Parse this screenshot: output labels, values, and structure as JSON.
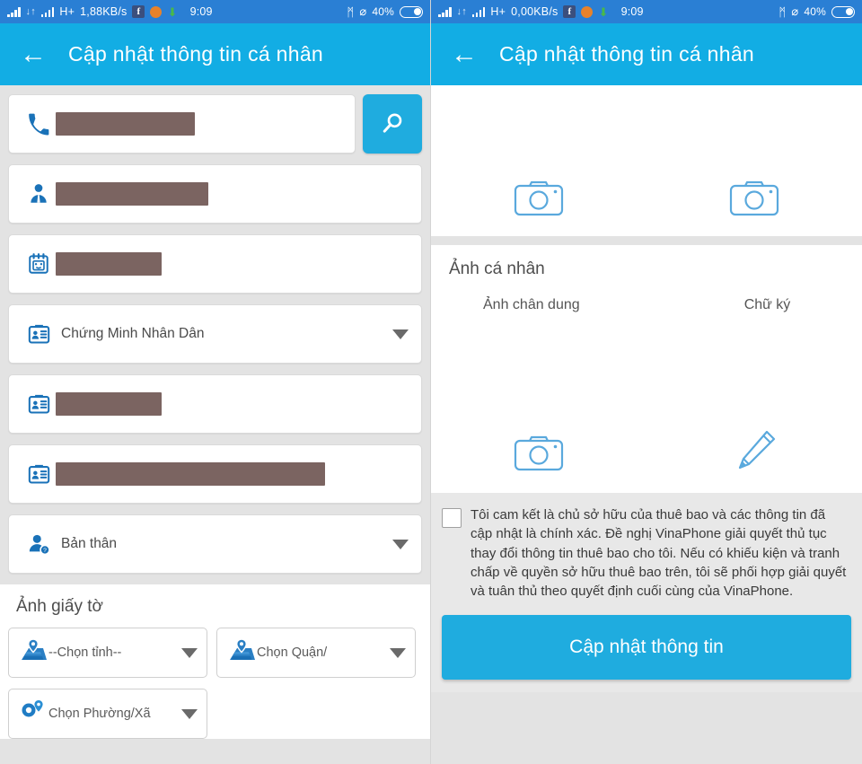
{
  "status_bar": {
    "network_type": "H+",
    "speed_left": "1,88KB/s",
    "speed_right": "0,00KB/s",
    "time": "9:09",
    "battery_pct": "40%",
    "icons": [
      "signal-bars-icon",
      "data-transfer-icon",
      "signal-bars-icon",
      "facebook-icon",
      "orange-app-icon",
      "download-arrow-icon",
      "bluetooth-icon",
      "mute-icon",
      "battery-icon"
    ],
    "facebook_glyph": "f",
    "download_glyph": "⬇",
    "bluetooth_glyph": "ᛗ",
    "mute_glyph": "⌀",
    "updown_glyph": "↓↑"
  },
  "app_bar": {
    "back_glyph": "←",
    "title": "Cập nhật thông tin cá nhân"
  },
  "left_pane": {
    "fields": [
      {
        "name": "phone-field",
        "icon": "phone-icon",
        "redacted": true,
        "redacted_width": 155,
        "value": "",
        "has_caret": false,
        "has_search": true
      },
      {
        "name": "fullname-field",
        "icon": "person-icon",
        "redacted": true,
        "redacted_width": 170,
        "value": "",
        "has_caret": false,
        "has_search": false
      },
      {
        "name": "birthdate-field",
        "icon": "calendar-icon",
        "redacted": true,
        "redacted_width": 118,
        "value": "",
        "has_caret": false,
        "has_search": false
      },
      {
        "name": "doctype-field",
        "icon": "id-card-icon",
        "redacted": false,
        "redacted_width": 0,
        "value": "Chứng Minh Nhân Dân",
        "has_caret": true,
        "has_search": false
      },
      {
        "name": "docnumber-field",
        "icon": "id-card-icon",
        "redacted": true,
        "redacted_width": 118,
        "value": "",
        "has_caret": false,
        "has_search": false
      },
      {
        "name": "docissue-field",
        "icon": "id-card-icon",
        "redacted": true,
        "redacted_width": 300,
        "value": "",
        "has_caret": false,
        "has_search": false
      },
      {
        "name": "relation-field",
        "icon": "person-question-icon",
        "redacted": false,
        "redacted_width": 0,
        "value": "Bản thân",
        "has_caret": true,
        "has_search": false
      }
    ],
    "search_button": {
      "icon": "search-icon"
    },
    "documents_section": {
      "title": "Ảnh giấy tờ",
      "location_selects": [
        {
          "name": "province-select",
          "icon": "map-pin-icon",
          "label": "--Chọn tỉnh--"
        },
        {
          "name": "district-select",
          "icon": "map-pin-icon",
          "label": "Chọn Quận/"
        },
        {
          "name": "ward-select",
          "icon": "map-marker-icon",
          "label": "Chọn Phường/Xã"
        }
      ]
    }
  },
  "right_pane": {
    "doc_photo_slots": [
      {
        "name": "doc-front-camera-slot",
        "icon": "camera-icon"
      },
      {
        "name": "doc-back-camera-slot",
        "icon": "camera-icon"
      }
    ],
    "personal_section": {
      "title": "Ảnh cá nhân",
      "labels": [
        "Ảnh chân dung",
        "Chữ ký"
      ],
      "slots": [
        {
          "name": "portrait-camera-slot",
          "icon": "camera-icon"
        },
        {
          "name": "signature-pen-slot",
          "icon": "pen-icon"
        }
      ]
    },
    "consent": {
      "checked": false,
      "text": "Tôi cam kết là chủ sở hữu của thuê bao và các thông tin đã cập nhật là chính xác. Đề nghị VinaPhone giải quyết thủ tục thay đổi thông tin thuê bao cho tôi. Nếu có khiếu kiện và tranh chấp về quyền sở hữu thuê bao trên, tôi sẽ phối hợp giải quyết và tuân thủ theo quyết định cuối cùng của VinaPhone."
    },
    "submit_label": "Cập nhật thông tin"
  },
  "colors": {
    "status_bar": "#2a7fd4",
    "app_bar": "#12ade4",
    "accent": "#1facdf",
    "icon_blue": "#1a72b8",
    "outline_blue": "#5aa9dd",
    "redaction": "#7b6461",
    "page_bg": "#e3e3e3"
  }
}
